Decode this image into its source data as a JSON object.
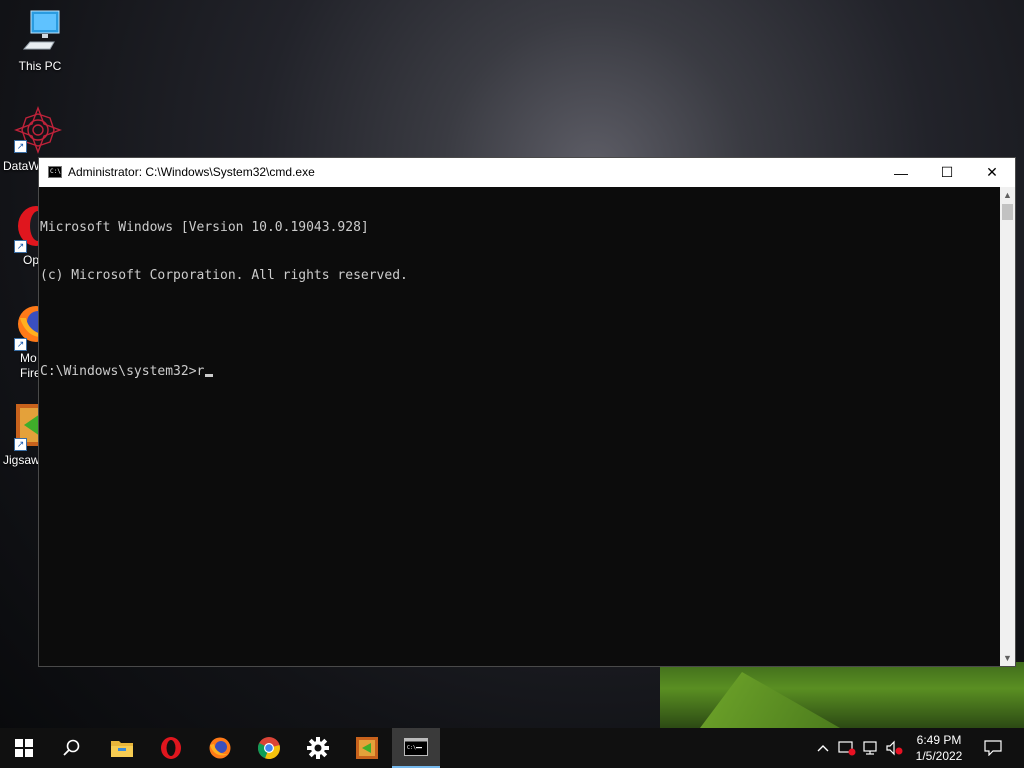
{
  "desktop": {
    "icons": [
      {
        "label": "This PC",
        "icon": "computer-icon"
      },
      {
        "label": "DataW",
        "icon": "datawrapper-icon"
      },
      {
        "label": "Op",
        "icon": "opera-icon"
      },
      {
        "label": "Mo\nFire",
        "icon": "firefox-icon"
      },
      {
        "label": "Jigsaw",
        "icon": "jigsaw-game-icon"
      }
    ]
  },
  "window": {
    "title": "Administrator: C:\\Windows\\System32\\cmd.exe",
    "minimize_glyph": "—",
    "maximize_glyph": "☐",
    "close_glyph": "✕",
    "console_lines": [
      "Microsoft Windows [Version 10.0.19043.928]",
      "(c) Microsoft Corporation. All rights reserved.",
      "",
      "C:\\Windows\\system32>r"
    ]
  },
  "taskbar": {
    "pinned": [
      "start-icon",
      "search-icon",
      "file-explorer-icon",
      "opera-icon",
      "firefox-icon",
      "chrome-icon",
      "settings-icon",
      "jigsaw-game-icon",
      "cmd-icon"
    ],
    "active_app": "cmd-icon",
    "time": "6:49 PM",
    "date": "1/5/2022"
  },
  "colors": {
    "console_bg": "#0c0c0c",
    "console_text": "#cccccc",
    "taskbar_bg": "#101010",
    "active_indicator": "#76b9ed"
  }
}
